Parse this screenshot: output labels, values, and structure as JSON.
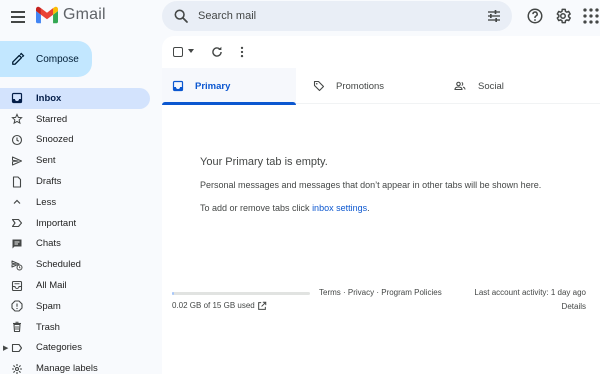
{
  "app": {
    "name": "Gmail"
  },
  "colors": {
    "compose_bg": "#c2e7ff",
    "active_nav_bg": "#d3e3fd",
    "accent": "#0b57d0",
    "search_bg": "#e9eef6"
  },
  "search": {
    "placeholder": "Search mail"
  },
  "header_icons": [
    "menu-icon",
    "search-icon",
    "tune-icon",
    "help-icon",
    "settings-icon",
    "apps-icon"
  ],
  "compose": {
    "label": "Compose"
  },
  "sidebar": {
    "items": [
      {
        "label": "Inbox",
        "icon": "inbox-icon",
        "active": true
      },
      {
        "label": "Starred",
        "icon": "star-icon"
      },
      {
        "label": "Snoozed",
        "icon": "clock-icon"
      },
      {
        "label": "Sent",
        "icon": "send-icon"
      },
      {
        "label": "Drafts",
        "icon": "draft-icon"
      },
      {
        "label": "Less",
        "icon": "chevron-up-icon"
      },
      {
        "label": "Important",
        "icon": "important-icon"
      },
      {
        "label": "Chats",
        "icon": "chat-icon"
      },
      {
        "label": "Scheduled",
        "icon": "schedule-send-icon"
      },
      {
        "label": "All Mail",
        "icon": "all-mail-icon"
      },
      {
        "label": "Spam",
        "icon": "spam-icon"
      },
      {
        "label": "Trash",
        "icon": "trash-icon"
      },
      {
        "label": "Categories",
        "icon": "label-icon"
      },
      {
        "label": "Manage labels",
        "icon": "manage-labels-icon"
      }
    ]
  },
  "tabs": [
    {
      "label": "Primary",
      "icon": "inbox-tab-icon",
      "active": true
    },
    {
      "label": "Promotions",
      "icon": "tag-icon"
    },
    {
      "label": "Social",
      "icon": "people-icon"
    }
  ],
  "empty_state": {
    "title": "Your Primary tab is empty.",
    "description": "Personal messages and messages that don’t appear in other tabs will be shown here.",
    "hint_prefix": "To add or remove tabs click ",
    "hint_link": "inbox settings",
    "hint_suffix": "."
  },
  "footer": {
    "storage_used_fraction": 0.0013,
    "storage_text": "0.02 GB of 15 GB used",
    "terms": "Terms",
    "privacy": "Privacy",
    "program_policies": "Program Policies",
    "separator": " · ",
    "last_activity": "Last account activity: 1 day ago",
    "details": "Details"
  }
}
